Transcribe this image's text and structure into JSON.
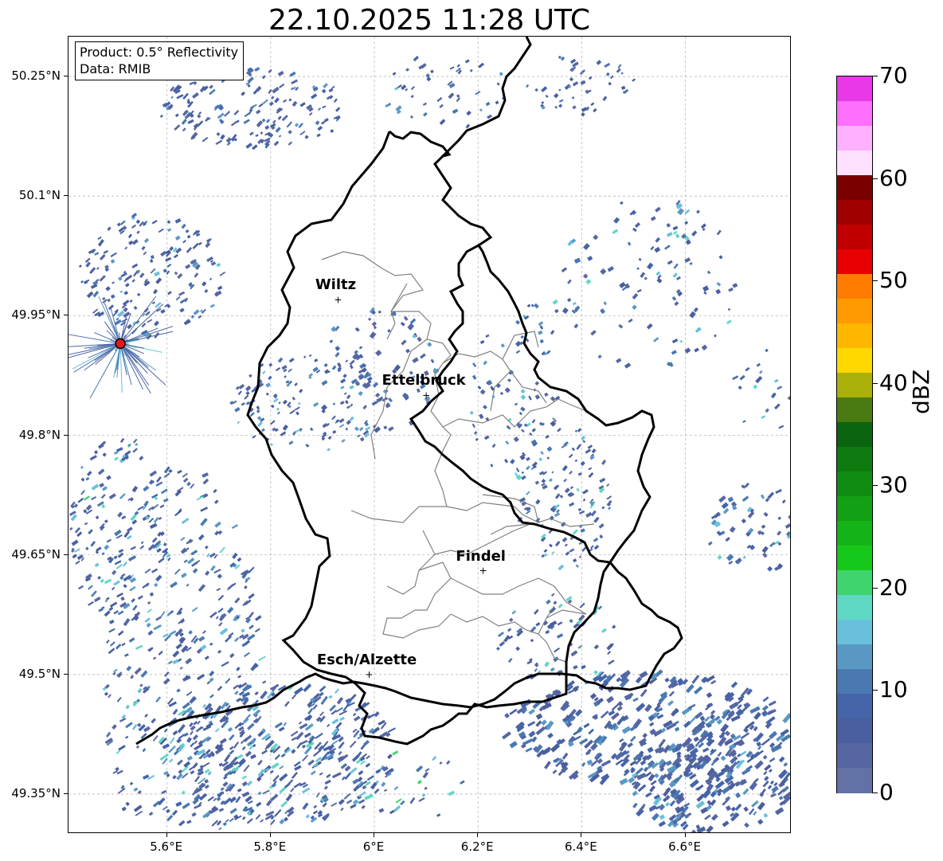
{
  "title": "22.10.2025 11:28 UTC",
  "info": {
    "product": "Product: 0.5° Reflectivity",
    "data": "Data: RMIB"
  },
  "lat_labels": [
    "50.25°N",
    "50.1°N",
    "49.95°N",
    "49.8°N",
    "49.65°N",
    "49.5°N",
    "49.35°N"
  ],
  "lon_labels": [
    "5.6°E",
    "5.8°E",
    "6°E",
    "6.2°E",
    "6.4°E",
    "6.6°E"
  ],
  "cities": [
    {
      "name": "Wiltz",
      "lon": 5.93,
      "lat": 49.97
    },
    {
      "name": "Ettelbruck",
      "lon": 6.1,
      "lat": 49.85
    },
    {
      "name": "Findel",
      "lon": 6.21,
      "lat": 49.63
    },
    {
      "name": "Esch/Alzette",
      "lon": 5.99,
      "lat": 49.5
    }
  ],
  "radar_site": {
    "lon": 5.51,
    "lat": 49.915,
    "color": "#e31a1c"
  },
  "map_extent": {
    "lon_min": 5.41,
    "lon_max": 6.805,
    "lat_min": 49.3,
    "lat_max": 50.3
  },
  "colorbar": {
    "label": "dBZ",
    "min": 0,
    "max": 70,
    "ticks": [
      "0",
      "10",
      "20",
      "30",
      "40",
      "50",
      "60",
      "70"
    ],
    "colors": [
      "#6272a6",
      "#5566a3",
      "#4a5fa0",
      "#4565a8",
      "#4a78b0",
      "#5a98c4",
      "#69c0dc",
      "#5fd8c4",
      "#3fd46e",
      "#16c81a",
      "#14b418",
      "#12a014",
      "#108c12",
      "#0e7a10",
      "#0a6410",
      "#4a7a12",
      "#aab00a",
      "#ffd800",
      "#ffb600",
      "#ff9a00",
      "#ff7c00",
      "#e80000",
      "#c00000",
      "#a00000",
      "#7a0000",
      "#ffe0ff",
      "#ffb0ff",
      "#ff70ff",
      "#e838e8"
    ]
  }
}
